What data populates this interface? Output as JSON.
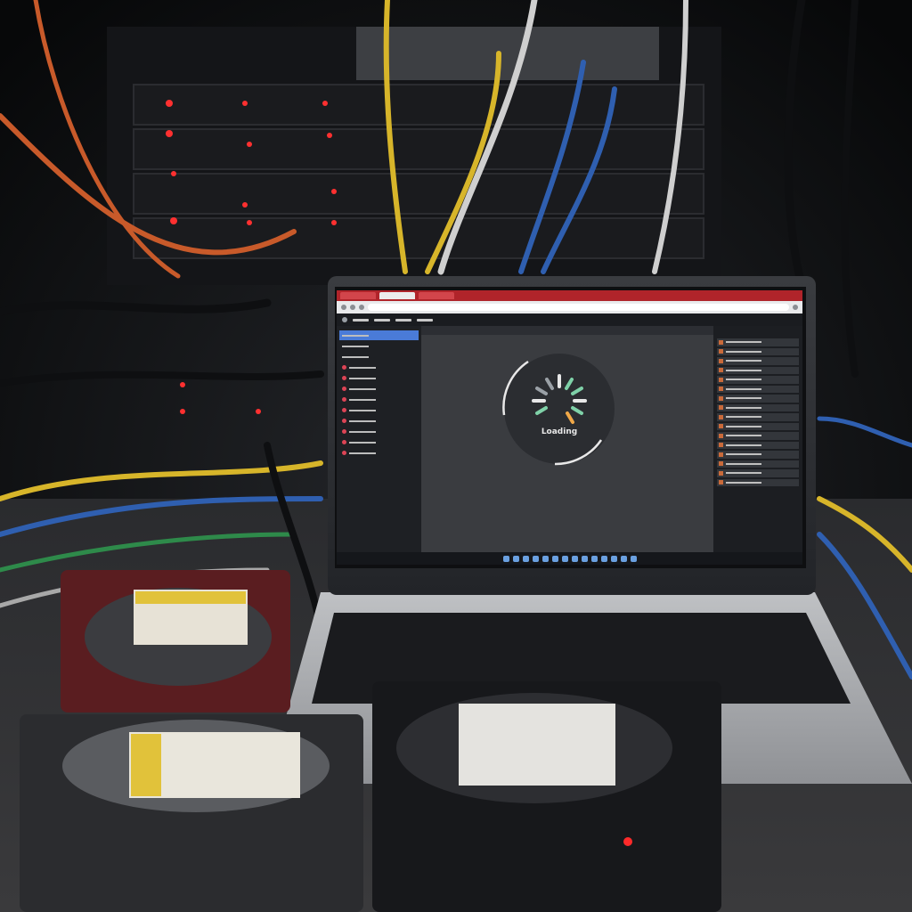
{
  "screen": {
    "loading_label": "Loading"
  },
  "colors": {
    "browser_tab_strip": "#b0242a",
    "sidebar_selected": "#4a7bd8",
    "spinner_ring": "#e8e8e8",
    "spinner_ticks": [
      "#e8e8e8",
      "#7fd1a8",
      "#f0a848",
      "#9aa0a6"
    ]
  }
}
